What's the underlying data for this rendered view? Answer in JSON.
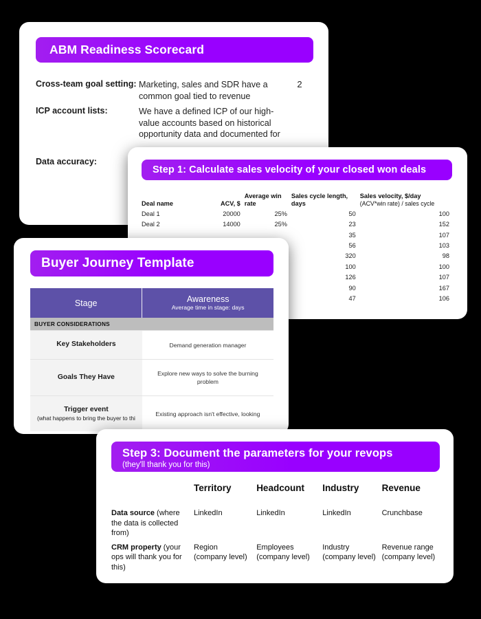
{
  "theme": {
    "background": "#000000",
    "banner_purple": "#9900ff",
    "banner_purple_light": "#a21ef0",
    "table_header_purple": "#5d51a8",
    "section_gray": "#bdbdbd"
  },
  "abm_scorecard": {
    "title": "ABM Readiness Scorecard",
    "rows": [
      {
        "label": "Cross-team goal setting:",
        "description": "Marketing, sales and SDR have a common goal tied to revenue",
        "score": "2"
      },
      {
        "label": "ICP account lists:",
        "description": "We have a defined ICP of our high-value accounts based on historical opportunity data and documented for",
        "score": ""
      },
      {
        "label": "Data accuracy:",
        "description": "",
        "score": ""
      }
    ]
  },
  "step1": {
    "title": "Step 1: Calculate sales velocity of your closed won deals",
    "chart_data": {
      "type": "table",
      "title": "Step 1: Calculate sales velocity of your closed won deals",
      "columns": [
        "Deal name",
        "ACV, $",
        "Average win rate",
        "Sales cycle length, days",
        "Sales velocity, $/day"
      ],
      "column_subheads": [
        "",
        "",
        "",
        "",
        "(ACV*win rate) / sales cycle"
      ],
      "rows": [
        [
          "Deal 1",
          "20000",
          "25%",
          "50",
          "100"
        ],
        [
          "Deal 2",
          "14000",
          "25%",
          "23",
          "152"
        ],
        [
          "",
          "",
          "",
          "35",
          "107"
        ],
        [
          "",
          "",
          "",
          "56",
          "103"
        ],
        [
          "",
          "",
          "",
          "320",
          "98"
        ],
        [
          "",
          "",
          "",
          "100",
          "100"
        ],
        [
          "",
          "",
          "",
          "126",
          "107"
        ],
        [
          "",
          "",
          "",
          "90",
          "167"
        ],
        [
          "",
          "",
          "",
          "47",
          "106"
        ]
      ]
    }
  },
  "buyer_journey": {
    "title": "Buyer Journey Template",
    "header": {
      "stage_label": "Stage",
      "column_title": "Awareness",
      "column_subtitle": "Average time in stage: days"
    },
    "section_label": "BUYER CONSIDERATIONS",
    "rows": [
      {
        "label": "Key Stakeholders",
        "sublabel": "",
        "value": "Demand generation manager"
      },
      {
        "label": "Goals They Have",
        "sublabel": "",
        "value": "Explore new ways to solve the burning problem"
      },
      {
        "label": "Trigger event",
        "sublabel": "(what happens to bring the buyer to thi",
        "value": "Existing approach isn't effective, looking"
      }
    ]
  },
  "step3": {
    "title": "Step 3: Document the parameters for your revops",
    "subtitle": "(they'll thank you for this)",
    "columns": [
      "Territory",
      "Headcount",
      "Industry",
      "Revenue"
    ],
    "rows": [
      {
        "label_bold": "Data source",
        "label_plain": " (where the data is collected from)",
        "values": [
          "LinkedIn",
          "LinkedIn",
          "LinkedIn",
          "Crunchbase"
        ]
      },
      {
        "label_bold": "CRM property",
        "label_plain": " (your ops will thank you for this)",
        "values": [
          "Region (company level)",
          "Employees (company level)",
          "Industry (company level)",
          "Revenue range (company level)"
        ]
      }
    ]
  }
}
